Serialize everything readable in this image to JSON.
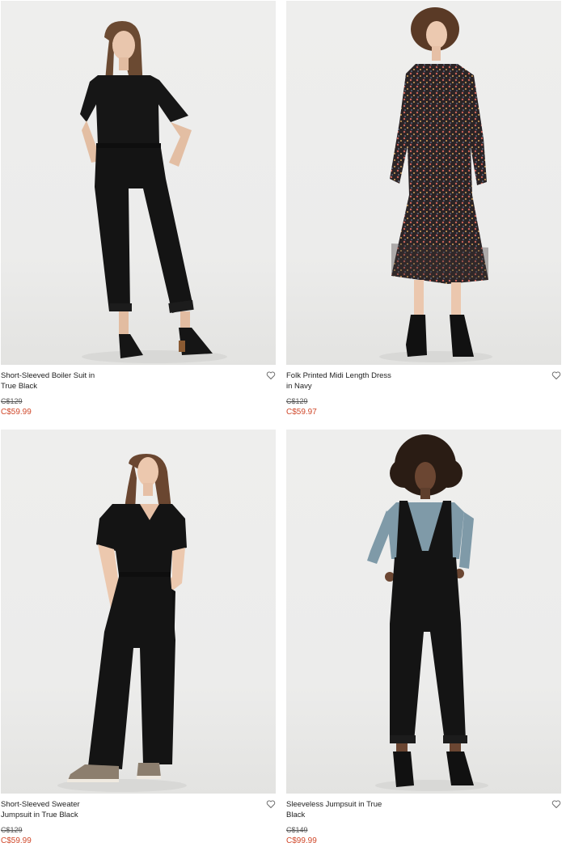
{
  "products": [
    {
      "name": "Short-Sleeved Boiler Suit in True Black",
      "original_price": "C$129",
      "sale_price": "C$59.99",
      "image": "model-black-boiler-suit",
      "favorite_icon": "heart-outline-icon"
    },
    {
      "name": "Folk Printed Midi Length Dress in Navy",
      "original_price": "C$129",
      "sale_price": "C$59.97",
      "image": "model-floral-midi-dress",
      "favorite_icon": "heart-outline-icon"
    },
    {
      "name": "Short-Sleeved Sweater Jumpsuit in True Black",
      "original_price": "C$129",
      "sale_price": "C$59.99",
      "image": "model-black-sweater-jumpsuit",
      "favorite_icon": "heart-outline-icon"
    },
    {
      "name": "Sleeveless Jumpsuit in True Black",
      "original_price": "C$149",
      "sale_price": "C$99.99",
      "image": "model-sleeveless-jumpsuit",
      "favorite_icon": "heart-outline-icon"
    }
  ],
  "colors": {
    "sale_price": "#d0482a",
    "text": "#222222",
    "photo_background": "#eeeeed"
  }
}
